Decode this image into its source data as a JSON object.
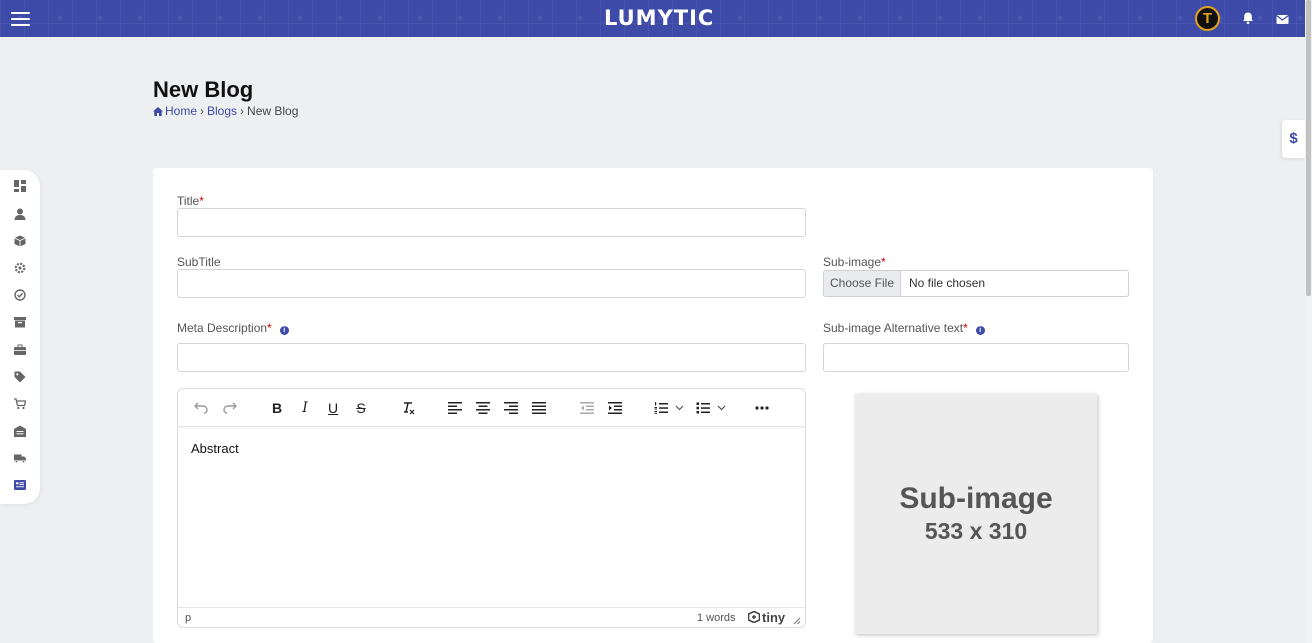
{
  "header": {
    "brand": "LUMYTIC",
    "avatar_letter": "T"
  },
  "currency_symbol": "$",
  "page": {
    "title": "New Blog",
    "breadcrumb": {
      "home": "Home",
      "sep1": "›",
      "blogs": "Blogs",
      "sep2": "›",
      "current": "New Blog"
    }
  },
  "sidenav": {
    "items": [
      "dashboard-icon",
      "user-icon",
      "box-icon",
      "gear-icon",
      "check-circle-icon",
      "archive-icon",
      "briefcase-icon",
      "tag-icon",
      "cart-icon",
      "warehouse-icon",
      "truck-icon",
      "blog-icon"
    ]
  },
  "form": {
    "title_label": "Title",
    "subtitle_label": "SubTitle",
    "meta_label": "Meta Description",
    "subimage_label": "Sub-image",
    "subimage_alt_label": "Sub-image Alternative text",
    "required_mark": "*",
    "info_glyph": "i",
    "file_button": "Choose File",
    "file_status": "No file chosen",
    "title_value": "",
    "subtitle_value": "",
    "meta_value": "",
    "alt_value": ""
  },
  "editor": {
    "content": "Abstract",
    "path": "p",
    "word_count": "1 words",
    "brand": "tiny"
  },
  "placeholder": {
    "title": "Sub-image",
    "size": "533 x 310"
  },
  "colors": {
    "accent": "#3d4aa8",
    "required": "#cc0000"
  }
}
